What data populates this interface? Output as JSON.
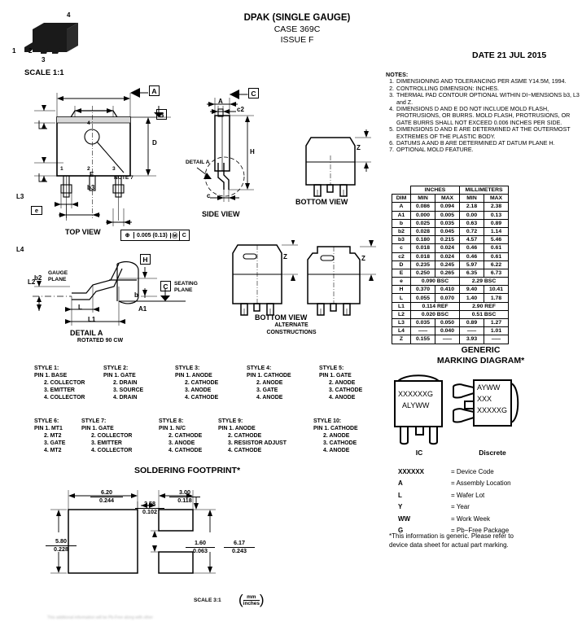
{
  "header": {
    "title": "DPAK (SINGLE GAUGE)",
    "case": "CASE 369C",
    "issue": "ISSUE F",
    "date": "DATE 21 JUL 2015",
    "scale": "SCALE 1:1"
  },
  "package_icon": {
    "pins": [
      "1",
      "2",
      "3",
      "4"
    ]
  },
  "notes": {
    "heading": "NOTES:",
    "items": [
      "DIMENSIONING AND TOLERANCING PER ASME Y14.5M, 1994.",
      "CONTROLLING DIMENSION: INCHES.",
      "THERMAL PAD CONTOUR OPTIONAL WITHIN DI−MENSIONS b3, L3 and Z.",
      "DIMENSIONS D AND E DO NOT INCLUDE MOLD FLASH, PROTRUSIONS, OR BURRS. MOLD FLASH, PROTRUSIONS, OR GATE BURRS SHALL NOT EXCEED 0.006 INCHES PER SIDE.",
      "DIMENSIONS D AND E ARE DETERMINED AT THE OUTERMOST EXTREMES OF THE PLASTIC BODY.",
      "DATUMS A AND B ARE DETERMINED AT DATUM PLANE H.",
      "OPTIONAL MOLD FEATURE."
    ]
  },
  "dim_table": {
    "group_headers": [
      "INCHES",
      "MILLIMETERS"
    ],
    "columns": [
      "DIM",
      "MIN",
      "MAX",
      "MIN",
      "MAX"
    ],
    "rows": [
      {
        "dim": "A",
        "in_min": "0.086",
        "in_max": "0.094",
        "mm_min": "2.18",
        "mm_max": "2.38"
      },
      {
        "dim": "A1",
        "in_min": "0.000",
        "in_max": "0.005",
        "mm_min": "0.00",
        "mm_max": "0.13"
      },
      {
        "dim": "b",
        "in_min": "0.025",
        "in_max": "0.035",
        "mm_min": "0.63",
        "mm_max": "0.89"
      },
      {
        "dim": "b2",
        "in_min": "0.028",
        "in_max": "0.045",
        "mm_min": "0.72",
        "mm_max": "1.14"
      },
      {
        "dim": "b3",
        "in_min": "0.180",
        "in_max": "0.215",
        "mm_min": "4.57",
        "mm_max": "5.46"
      },
      {
        "dim": "c",
        "in_min": "0.018",
        "in_max": "0.024",
        "mm_min": "0.46",
        "mm_max": "0.61"
      },
      {
        "dim": "c2",
        "in_min": "0.018",
        "in_max": "0.024",
        "mm_min": "0.46",
        "mm_max": "0.61"
      },
      {
        "dim": "D",
        "in_min": "0.235",
        "in_max": "0.245",
        "mm_min": "5.97",
        "mm_max": "6.22"
      },
      {
        "dim": "E",
        "in_min": "0.250",
        "in_max": "0.265",
        "mm_min": "6.35",
        "mm_max": "6.73"
      },
      {
        "dim": "e",
        "in_span": "0.090 BSC",
        "mm_span": "2.29 BSC"
      },
      {
        "dim": "H",
        "in_min": "0.370",
        "in_max": "0.410",
        "mm_min": "9.40",
        "mm_max": "10.41"
      },
      {
        "dim": "L",
        "in_min": "0.055",
        "in_max": "0.070",
        "mm_min": "1.40",
        "mm_max": "1.78"
      },
      {
        "dim": "L1",
        "in_span": "0.114 REF",
        "mm_span": "2.90 REF"
      },
      {
        "dim": "L2",
        "in_span": "0.020 BSC",
        "mm_span": "0.51 BSC"
      },
      {
        "dim": "L3",
        "in_min": "0.035",
        "in_max": "0.050",
        "mm_min": "0.89",
        "mm_max": "1.27"
      },
      {
        "dim": "L4",
        "in_min": "‒‒‒",
        "in_max": "0.040",
        "mm_min": "‒‒‒",
        "mm_max": "1.01"
      },
      {
        "dim": "Z",
        "in_min": "0.155",
        "in_max": "‒‒‒",
        "mm_min": "3.93",
        "mm_max": "‒‒‒"
      }
    ]
  },
  "top_view": {
    "name": "TOP VIEW",
    "labels": [
      "E",
      "b3",
      "L3",
      "L4",
      "b2",
      "e",
      "b",
      "D",
      "A",
      "B"
    ],
    "pin_numbers": [
      "1",
      "2",
      "3",
      "4"
    ],
    "note_ref": "NOTE 7",
    "tolerance": "0.005 (0.13)",
    "tolerance_datum": "C"
  },
  "side_view": {
    "name": "SIDE VIEW",
    "labels": [
      "A",
      "c2",
      "H",
      "c",
      "C"
    ],
    "detail_ref": "DETAIL A"
  },
  "bottom_view": {
    "name": "BOTTOM VIEW",
    "label": "Z"
  },
  "bottom_view_alt": {
    "name": "BOTTOM VIEW",
    "sub1": "ALTERNATE",
    "sub2": "CONSTRUCTIONS",
    "label": "Z"
  },
  "detail_a": {
    "name": "DETAIL A",
    "sub": "ROTATED 90 CW",
    "gauge_plane": "GAUGE\nPLANE",
    "gauge_plane_l1": "GAUGE",
    "gauge_plane_l2": "PLANE",
    "seating_plane_l1": "SEATING",
    "seating_plane_l2": "PLANE",
    "labels": [
      "L2",
      "L",
      "L1",
      "A1",
      "H",
      "C"
    ]
  },
  "styles": {
    "list": [
      {
        "title": "STYLE 1:",
        "pins": [
          "PIN 1. BASE",
          "2. COLLECTOR",
          "3. EMITTER",
          "4. COLLECTOR"
        ]
      },
      {
        "title": "STYLE 2:",
        "pins": [
          "PIN 1. GATE",
          "2. DRAIN",
          "3. SOURCE",
          "4. DRAIN"
        ]
      },
      {
        "title": "STYLE 3:",
        "pins": [
          "PIN 1. ANODE",
          "2. CATHODE",
          "3. ANODE",
          "4. CATHODE"
        ]
      },
      {
        "title": "STYLE 4:",
        "pins": [
          "PIN 1. CATHODE",
          "2. ANODE",
          "3. GATE",
          "4. ANODE"
        ]
      },
      {
        "title": "STYLE 5:",
        "pins": [
          "PIN 1. GATE",
          "2. ANODE",
          "3. CATHODE",
          "4. ANODE"
        ]
      },
      {
        "title": "STYLE 6:",
        "pins": [
          "PIN 1. MT1",
          "2. MT2",
          "3. GATE",
          "4. MT2"
        ]
      },
      {
        "title": "STYLE 7:",
        "pins": [
          "PIN 1. GATE",
          "2. COLLECTOR",
          "3. EMITTER",
          "4. COLLECTOR"
        ]
      },
      {
        "title": "STYLE 8:",
        "pins": [
          "PIN 1. N/C",
          "2. CATHODE",
          "3. ANODE",
          "4. CATHODE"
        ]
      },
      {
        "title": "STYLE 9:",
        "pins": [
          "PIN 1. ANODE",
          "2. CATHODE",
          "3. RESISTOR ADJUST",
          "4. CATHODE"
        ]
      },
      {
        "title": "STYLE 10:",
        "pins": [
          "PIN 1. CATHODE",
          "2. ANODE",
          "3. CATHODE",
          "4. ANODE"
        ]
      }
    ]
  },
  "marking": {
    "title_line1": "GENERIC",
    "title_line2": "MARKING DIAGRAM*",
    "ic_label": "IC",
    "discrete_label": "Discrete",
    "ic_lines": [
      "XXXXXXG",
      "ALYWW"
    ],
    "discrete_lines": [
      "AYWW",
      "XXX",
      "XXXXXG"
    ],
    "legend": [
      {
        "key": "XXXXXX",
        "value": "= Device Code"
      },
      {
        "key": "A",
        "value": "= Assembly Location"
      },
      {
        "key": "L",
        "value": "= Wafer Lot"
      },
      {
        "key": "Y",
        "value": "=  Year"
      },
      {
        "key": "WW",
        "value": "= Work Week"
      },
      {
        "key": "G",
        "value": "= Pb−Free Package"
      }
    ],
    "footnote": "*This information is generic. Please refer to device data sheet for actual part marking."
  },
  "soldering": {
    "title": "SOLDERING FOOTPRINT*",
    "scale": "SCALE 3:1",
    "unit_top": "mm",
    "unit_bot": "inches",
    "dims": [
      {
        "name": "pad-width",
        "mm": "6.20",
        "in": "0.244"
      },
      {
        "name": "gap",
        "mm": "2.58",
        "in": "0.102"
      },
      {
        "name": "lead-pad-width",
        "mm": "3.00",
        "in": "0.118"
      },
      {
        "name": "pad-height",
        "mm": "5.80",
        "in": "0.228"
      },
      {
        "name": "lead-pad-gap",
        "mm": "1.60",
        "in": "0.063"
      },
      {
        "name": "overall-height",
        "mm": "6.17",
        "in": "0.243"
      }
    ]
  },
  "footer": {
    "text": "This additional information will be Pb-Free along with other"
  }
}
